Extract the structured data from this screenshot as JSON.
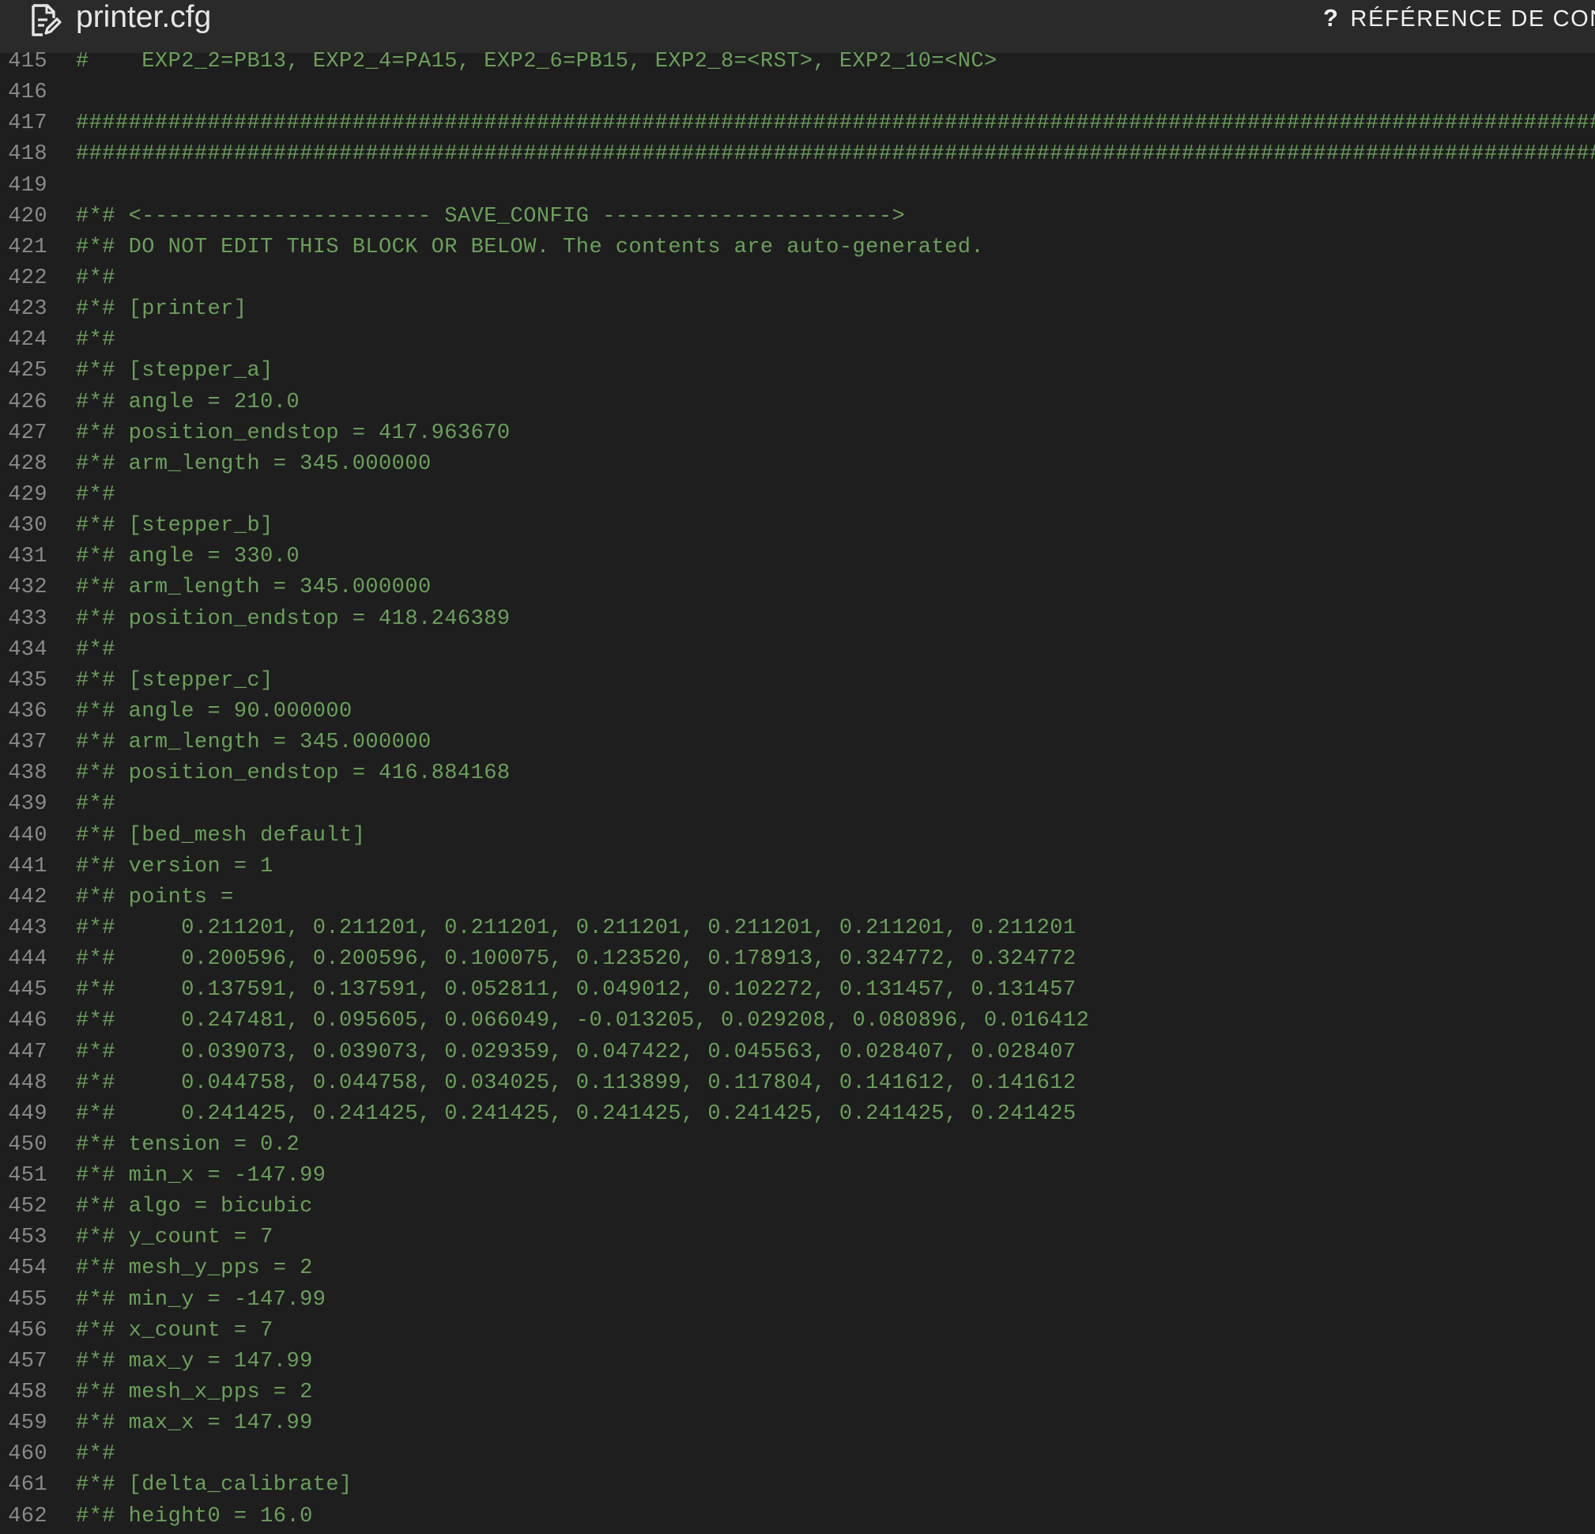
{
  "header": {
    "file_icon": "file-edit-icon",
    "file_name": "printer.cfg",
    "help_icon": "question-mark-icon",
    "help_icon_glyph": "?",
    "reference_label": "RÉFÉRENCE DE CONF"
  },
  "editor": {
    "lines": [
      {
        "n": "415",
        "t": "#    EXP2_2=PB13, EXP2_4=PA15, EXP2_6=PB15, EXP2_8=<RST>, EXP2_10=<NC>"
      },
      {
        "n": "416",
        "t": ""
      },
      {
        "n": "417",
        "t": "#############################################################################################################################"
      },
      {
        "n": "418",
        "t": "#############################################################################################################################"
      },
      {
        "n": "419",
        "t": ""
      },
      {
        "n": "420",
        "t": "#*# <---------------------- SAVE_CONFIG ---------------------->"
      },
      {
        "n": "421",
        "t": "#*# DO NOT EDIT THIS BLOCK OR BELOW. The contents are auto-generated."
      },
      {
        "n": "422",
        "t": "#*#"
      },
      {
        "n": "423",
        "t": "#*# [printer]"
      },
      {
        "n": "424",
        "t": "#*#"
      },
      {
        "n": "425",
        "t": "#*# [stepper_a]"
      },
      {
        "n": "426",
        "t": "#*# angle = 210.0"
      },
      {
        "n": "427",
        "t": "#*# position_endstop = 417.963670"
      },
      {
        "n": "428",
        "t": "#*# arm_length = 345.000000"
      },
      {
        "n": "429",
        "t": "#*#"
      },
      {
        "n": "430",
        "t": "#*# [stepper_b]"
      },
      {
        "n": "431",
        "t": "#*# angle = 330.0"
      },
      {
        "n": "432",
        "t": "#*# arm_length = 345.000000"
      },
      {
        "n": "433",
        "t": "#*# position_endstop = 418.246389"
      },
      {
        "n": "434",
        "t": "#*#"
      },
      {
        "n": "435",
        "t": "#*# [stepper_c]"
      },
      {
        "n": "436",
        "t": "#*# angle = 90.000000"
      },
      {
        "n": "437",
        "t": "#*# arm_length = 345.000000"
      },
      {
        "n": "438",
        "t": "#*# position_endstop = 416.884168"
      },
      {
        "n": "439",
        "t": "#*#"
      },
      {
        "n": "440",
        "t": "#*# [bed_mesh default]"
      },
      {
        "n": "441",
        "t": "#*# version = 1"
      },
      {
        "n": "442",
        "t": "#*# points ="
      },
      {
        "n": "443",
        "t": "#*#     0.211201, 0.211201, 0.211201, 0.211201, 0.211201, 0.211201, 0.211201"
      },
      {
        "n": "444",
        "t": "#*#     0.200596, 0.200596, 0.100075, 0.123520, 0.178913, 0.324772, 0.324772"
      },
      {
        "n": "445",
        "t": "#*#     0.137591, 0.137591, 0.052811, 0.049012, 0.102272, 0.131457, 0.131457"
      },
      {
        "n": "446",
        "t": "#*#     0.247481, 0.095605, 0.066049, -0.013205, 0.029208, 0.080896, 0.016412"
      },
      {
        "n": "447",
        "t": "#*#     0.039073, 0.039073, 0.029359, 0.047422, 0.045563, 0.028407, 0.028407"
      },
      {
        "n": "448",
        "t": "#*#     0.044758, 0.044758, 0.034025, 0.113899, 0.117804, 0.141612, 0.141612"
      },
      {
        "n": "449",
        "t": "#*#     0.241425, 0.241425, 0.241425, 0.241425, 0.241425, 0.241425, 0.241425"
      },
      {
        "n": "450",
        "t": "#*# tension = 0.2"
      },
      {
        "n": "451",
        "t": "#*# min_x = -147.99"
      },
      {
        "n": "452",
        "t": "#*# algo = bicubic"
      },
      {
        "n": "453",
        "t": "#*# y_count = 7"
      },
      {
        "n": "454",
        "t": "#*# mesh_y_pps = 2"
      },
      {
        "n": "455",
        "t": "#*# min_y = -147.99"
      },
      {
        "n": "456",
        "t": "#*# x_count = 7"
      },
      {
        "n": "457",
        "t": "#*# max_y = 147.99"
      },
      {
        "n": "458",
        "t": "#*# mesh_x_pps = 2"
      },
      {
        "n": "459",
        "t": "#*# max_x = 147.99"
      },
      {
        "n": "460",
        "t": "#*#"
      },
      {
        "n": "461",
        "t": "#*# [delta_calibrate]"
      },
      {
        "n": "462",
        "t": "#*# height0 = 16.0"
      }
    ]
  },
  "colors": {
    "background": "#1e1e1e",
    "header_background": "#2a2a2a",
    "comment": "#6aa05a",
    "line_number": "#8a8a8a",
    "header_text": "#e6e6e6"
  }
}
